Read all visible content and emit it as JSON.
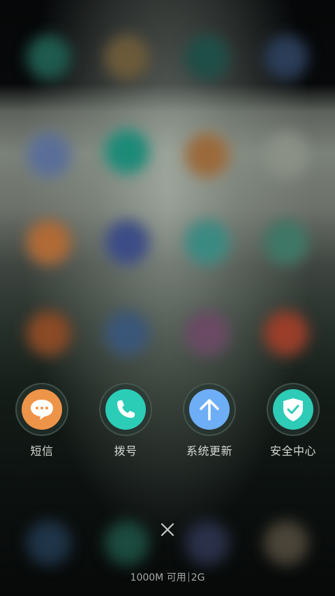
{
  "shortcuts": [
    {
      "id": "sms",
      "label": "短信",
      "icon": "message-bubble-icon",
      "color": "#EE9449"
    },
    {
      "id": "dialer",
      "label": "拨号",
      "icon": "phone-icon",
      "color": "#2BCDB7"
    },
    {
      "id": "update",
      "label": "系统更新",
      "icon": "arrow-up-icon",
      "color": "#6EAEF6"
    },
    {
      "id": "security",
      "label": "安全中心",
      "icon": "shield-check-icon",
      "color": "#2ECBB6"
    }
  ],
  "close_icon": "close-icon",
  "memory": {
    "available": "1000M 可用",
    "total": "2G"
  }
}
